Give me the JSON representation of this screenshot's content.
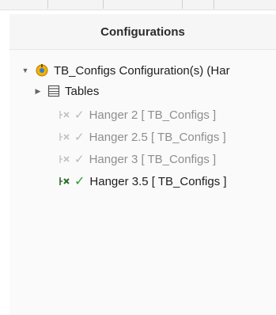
{
  "panel": {
    "title": "Configurations"
  },
  "tree": {
    "root": {
      "label": "TB_Configs Configuration(s)  (Har",
      "icon": "configuration-icon"
    },
    "folder": {
      "label": "Tables",
      "icon": "table-folder-icon"
    },
    "configs": [
      {
        "label": "Hanger 2 [ TB_Configs ]",
        "active": false
      },
      {
        "label": "Hanger 2.5 [ TB_Configs ]",
        "active": false
      },
      {
        "label": "Hanger 3 [ TB_Configs ]",
        "active": false
      },
      {
        "label": "Hanger 3.5 [ TB_Configs ]",
        "active": true
      }
    ]
  },
  "colors": {
    "active_check": "#2f9a2f",
    "inactive_text": "#8e8e8e",
    "root_icon": "#e0a100"
  }
}
